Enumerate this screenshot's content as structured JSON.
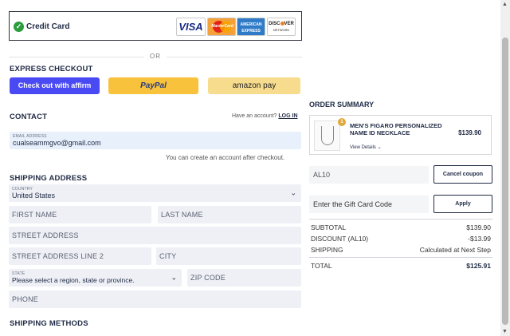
{
  "payment": {
    "selected_label": "Credit Card",
    "cards": [
      "VISA",
      "MasterCard",
      "American Express",
      "DISCOVER"
    ],
    "card_visa": "VISA",
    "card_mc": "MasterCard",
    "card_amex_line1": "AMERICAN",
    "card_amex_line2": "EXPRESS",
    "card_disc": "DISC",
    "card_disc2": "VER",
    "card_disc_sub": "NETWORK"
  },
  "divider": {
    "or": "OR"
  },
  "express": {
    "title": "EXPRESS CHECKOUT",
    "affirm_label": "Check out with affirm",
    "paypal_label": "PayPal",
    "amazon_label": "amazon pay"
  },
  "contact": {
    "title": "CONTACT",
    "have_account": "Have an account?",
    "login": "LOG IN",
    "email_label": "EMAIL ADDRESS",
    "email_value": "cualseammgvo@gmail.com",
    "hint": "You can create an account after checkout."
  },
  "shipping": {
    "title": "SHIPPING ADDRESS",
    "country_label": "COUNTRY",
    "country_value": "United States",
    "first_name": "FIRST NAME",
    "last_name": "LAST NAME",
    "street": "STREET ADDRESS",
    "street2": "STREET ADDRESS LINE 2",
    "city": "CITY",
    "state_label": "STATE",
    "state_value": "Please select a region, state or province.",
    "zip": "ZIP CODE",
    "phone": "PHONE",
    "methods_title": "SHIPPING METHODS"
  },
  "order": {
    "title": "ORDER SUMMARY",
    "product_name": "MEN'S FIGARO PERSONALIZED NAME ID NECKLACE",
    "product_price": "$139.90",
    "product_qty": "1",
    "view_details": "View Details",
    "coupon_value": "AL10",
    "cancel_coupon": "Cancel coupon",
    "gift_placeholder": "Enter the Gift Card Code",
    "apply": "Apply",
    "subtotal_label": "SUBTOTAL",
    "subtotal": "$139.90",
    "discount_label": "DISCOUNT (AL10)",
    "discount": "-$13.99",
    "shipping_label": "SHIPPING",
    "shipping": "Calculated at Next Step",
    "total_label": "TOTAL",
    "total": "$125.91"
  }
}
